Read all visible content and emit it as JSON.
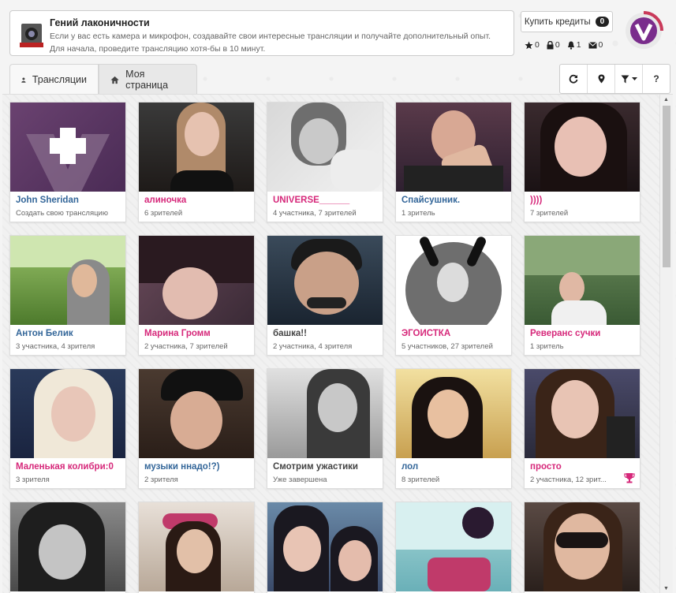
{
  "achievement": {
    "title": "Гений лаконичности",
    "text": "Если у вас есть камера и микрофон, создавайте свои интересные трансляции и получайте дополнительный опыт. Для начала, проведите трансляцию хотя-бы в 10 минут."
  },
  "credits": {
    "label": "Купить кредиты",
    "count": "0"
  },
  "stats": {
    "stars": "0",
    "locks": "0",
    "bells": "1",
    "messages": "0"
  },
  "tabs": {
    "broadcasts": "Трансляции",
    "my_page": "Моя страница"
  },
  "toolbar": {
    "help": "?"
  },
  "colors": {
    "pink": "#d6287a",
    "blue": "#336699",
    "logo": "#7a2d8c"
  },
  "cards": [
    {
      "name": "John Sheridan",
      "sub": "Создать свою трансляцию"
    },
    {
      "name": "алиночка",
      "sub": "6 зрителей"
    },
    {
      "name": "UNIVERSE______",
      "sub": "4 участника, 7 зрителей"
    },
    {
      "name": "Спайсушник.",
      "sub": "1 зритель"
    },
    {
      "name": ")))) ",
      "sub": "7 зрителей"
    },
    {
      "name": "Антон Белик",
      "sub": "3 участника, 4 зрителя"
    },
    {
      "name": "Марина Громм",
      "sub": "2 участника, 7 зрителей"
    },
    {
      "name": "башка!!",
      "sub": "2 участника, 4 зрителя"
    },
    {
      "name": "ЭГОИСТКА",
      "sub": "5 участников, 27 зрителей"
    },
    {
      "name": "Реверанс сучки",
      "sub": "1 зритель"
    },
    {
      "name": "Маленькая колибри:0",
      "sub": "3 зрителя"
    },
    {
      "name": "музыки ннадо!?)",
      "sub": "2 зрителя"
    },
    {
      "name": "Смотрим ужастики",
      "sub": "Уже завершена"
    },
    {
      "name": "лол",
      "sub": "8 зрителей"
    },
    {
      "name": "просто",
      "sub": "2 участника, 12 зрит..."
    },
    {
      "name": "",
      "sub": ""
    },
    {
      "name": "",
      "sub": ""
    },
    {
      "name": "",
      "sub": ""
    },
    {
      "name": "",
      "sub": ""
    },
    {
      "name": "",
      "sub": ""
    }
  ]
}
